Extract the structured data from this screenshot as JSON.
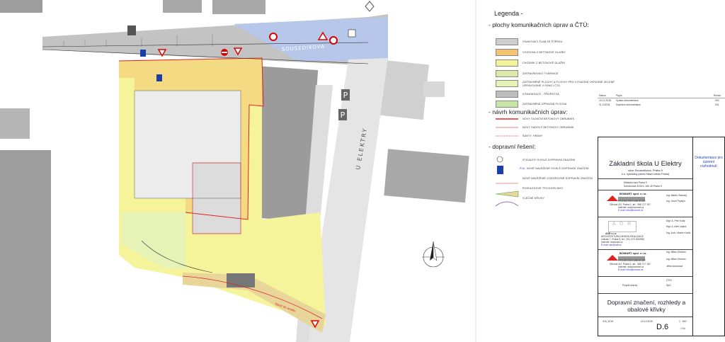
{
  "map": {
    "street_top": "SOUSEDÍKOVA",
    "street_right": "U ELEKTRY",
    "parking_labels": [
      "P",
      "P"
    ],
    "pedestrian_sign": "P",
    "lower_path_label": "Vjezd do areálu"
  },
  "legend": {
    "title": "Legenda -",
    "section1": "- plochy komunikačních úprav a ČTÚ:",
    "items1": [
      {
        "label": "VSAKOVACÍ ŽLAB ZE ŠTĚRKU",
        "color": "#cfcfcf"
      },
      {
        "label": "VOZOVKA Z BETONOVÉ DLAŽBY",
        "color": "#f3c571"
      },
      {
        "label": "CHODNÍK Z BETONOVÉ DLAŽBY",
        "color": "#f6f49a"
      },
      {
        "label": "ZATRAVŇOVACÍ TVÁRNICE",
        "color": "#dde9a8"
      },
      {
        "label": "ZATRAVNĚNÉ PLOCHY A PLOCHY PRO VYSAZENÍ OKRASNÉ ZELENĚ",
        "label2": "UPRAVOVANÉ V RÁMCI ČTÚ",
        "color": "#e6f2b6"
      },
      {
        "label": "KOMUNIKACE - TŘÍVRSTVÁ",
        "color": "#bdbdbd"
      },
      {
        "label": "ZATRAVNĚNÁ ÚPRAVNÁ PLOCHA",
        "color": "#c6e6a4"
      }
    ],
    "section2": "- návrh komunikačních úprav:",
    "items2": [
      {
        "label": "NOVÝ SILNIČNÍ BETONOVÝ OBRUBNÍK"
      },
      {
        "label": "NOVÝ SADOVÝ BETONOVÝ OBRUBNÍK"
      },
      {
        "label": "ŠANTY, HRANY"
      }
    ],
    "section3": "- dopravní řešení:",
    "items3": [
      {
        "label": "STÁVAJÍCÍ SVISLÉ DOPRAVNÍ ZNAČENÍ"
      },
      {
        "label": "NOVĚ NAVRŽENÉ SVISLÉ DOPRAVNÍ ZNAČENÍ",
        "tag": "P16"
      },
      {
        "label": "NOVĚ NAVRŽENÉ VODOROVNÉ DOPRAVNÍ ZNAČENÍ"
      },
      {
        "label": "ROZHLEDOVÉ TROJÚHELNÍKY"
      },
      {
        "label": "VLEČNÉ KŘIVKY"
      }
    ]
  },
  "revisions": {
    "headers": [
      "Datum",
      "Popis",
      "Revize"
    ],
    "rows": [
      [
        "10.12.2015",
        "Vydání dokumentace",
        "000"
      ],
      [
        "21.3.2016",
        "Doplnění dokumentace",
        "001"
      ]
    ]
  },
  "title_block": {
    "project": "Základní škola U Elektry",
    "project_sub": "ulice Sousedíkova, Praha 9",
    "project_sub2": "k.ú. Vysočany (okres Hlavní město Praha)",
    "stamp": "Dokumentace pro územní rozhodnutí",
    "investor": "Městská část Praha 9",
    "investor_addr": "Sokolovská 324/14, 180 49 Praha 9",
    "company1": "BOMART spol. s r.o.",
    "company1_sub": "PROJEKČNÍ KANCELÁŘ",
    "company1_addr": "Olivová 4/2, Praha 1, tel.: 386 717 157",
    "company1_web": "Internet: www.bomart.cz",
    "company1_mail": "E-mail: info@bomart.cz",
    "gip": "Ing. Martin Zárecký",
    "hip": "Ing. Josef Pryslýn",
    "architect1": "Mgr. A. Petr Kotal",
    "architect2": "Mgr. A. Aleš Lapka",
    "architect3": "Ing. Arch. Martin Kubík",
    "company2": "ADR s.r.o.",
    "company2_sub": "ARCHITEKTURA DESIGN REALIZACE",
    "company2_addr": "Lidická 7, Praha 5, tel.: 251 270 302/983",
    "company2_web": "Internet: www.adr.cz",
    "company2_mail": "E-mail: adr@adr.cz",
    "resp1": "Ing. Milan Ohebza",
    "resp2": "Ing. Milan Ohebza",
    "drawn": "Jiřina Amonová",
    "part": "Projekt stavby",
    "part_no": "ZTDI",
    "degree": "SpÚ",
    "drawing_title": "Dopravní značení, rozhledy a obalové křivky",
    "contract": "015_2015",
    "date": "10.12.2015",
    "scale": "1 : 500",
    "drawing_no": "D.6",
    "format": "2 A4"
  }
}
